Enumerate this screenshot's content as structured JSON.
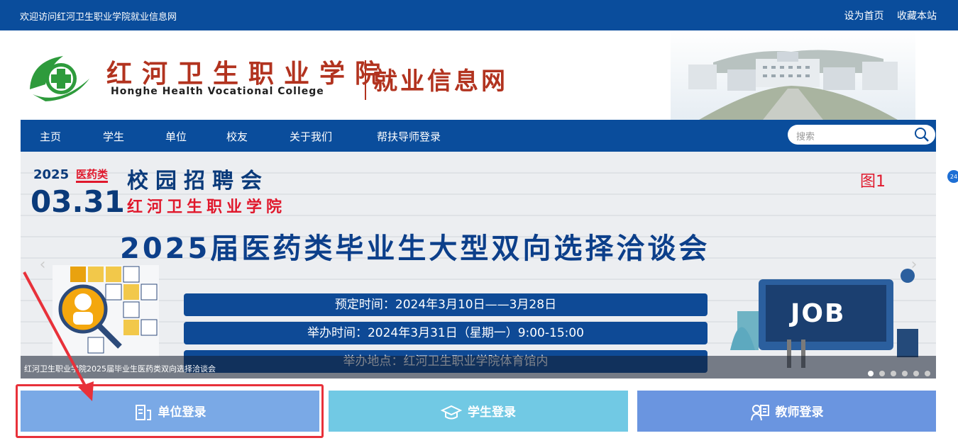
{
  "topbar": {
    "welcome": "欢迎访问红河卫生职业学院就业信息网",
    "set_home": "设为首页",
    "bookmark": "收藏本站"
  },
  "header": {
    "school_cn": "红河卫生职业学院",
    "school_en": "Honghe Health Vocational College",
    "site_name": "就业信息网"
  },
  "nav": {
    "items": [
      "主页",
      "学生",
      "单位",
      "校友",
      "关于我们",
      "帮扶导师登录"
    ],
    "search_placeholder": "搜索"
  },
  "banner": {
    "year": "2025",
    "tag": "医药类",
    "title": "校园招聘会",
    "date": "03.31",
    "school": "红河卫生职业学院",
    "figure_label": "图1",
    "main_title": "2025届医药类毕业生大型双向选择洽谈会",
    "booking_time": "预定时间：2024年3月10日——3月28日",
    "event_time": "举办时间：2024年3月31日（星期一）9:00-15:00",
    "venue": "举办地点：红河卫生职业学院体育馆内",
    "job_sign": "JOB",
    "caption": "红河卫生职业学院2025届毕业生医药类双向选择洽谈会",
    "slide_count": 6,
    "active_slide": 1
  },
  "login": {
    "employer": "单位登录",
    "student": "学生登录",
    "teacher": "教师登录"
  },
  "side_badge": "24",
  "colors": {
    "brand_blue": "#0a4d9c",
    "brand_red": "#b2331f",
    "employer_btn": "#7aa9e6",
    "student_btn": "#71c9e4",
    "teacher_btn": "#6a95e0",
    "highlight": "#e8313a"
  },
  "icons": [
    "search-icon",
    "building-icon",
    "graduation-cap-icon",
    "teacher-icon",
    "arrow-left-icon",
    "arrow-right-icon"
  ]
}
